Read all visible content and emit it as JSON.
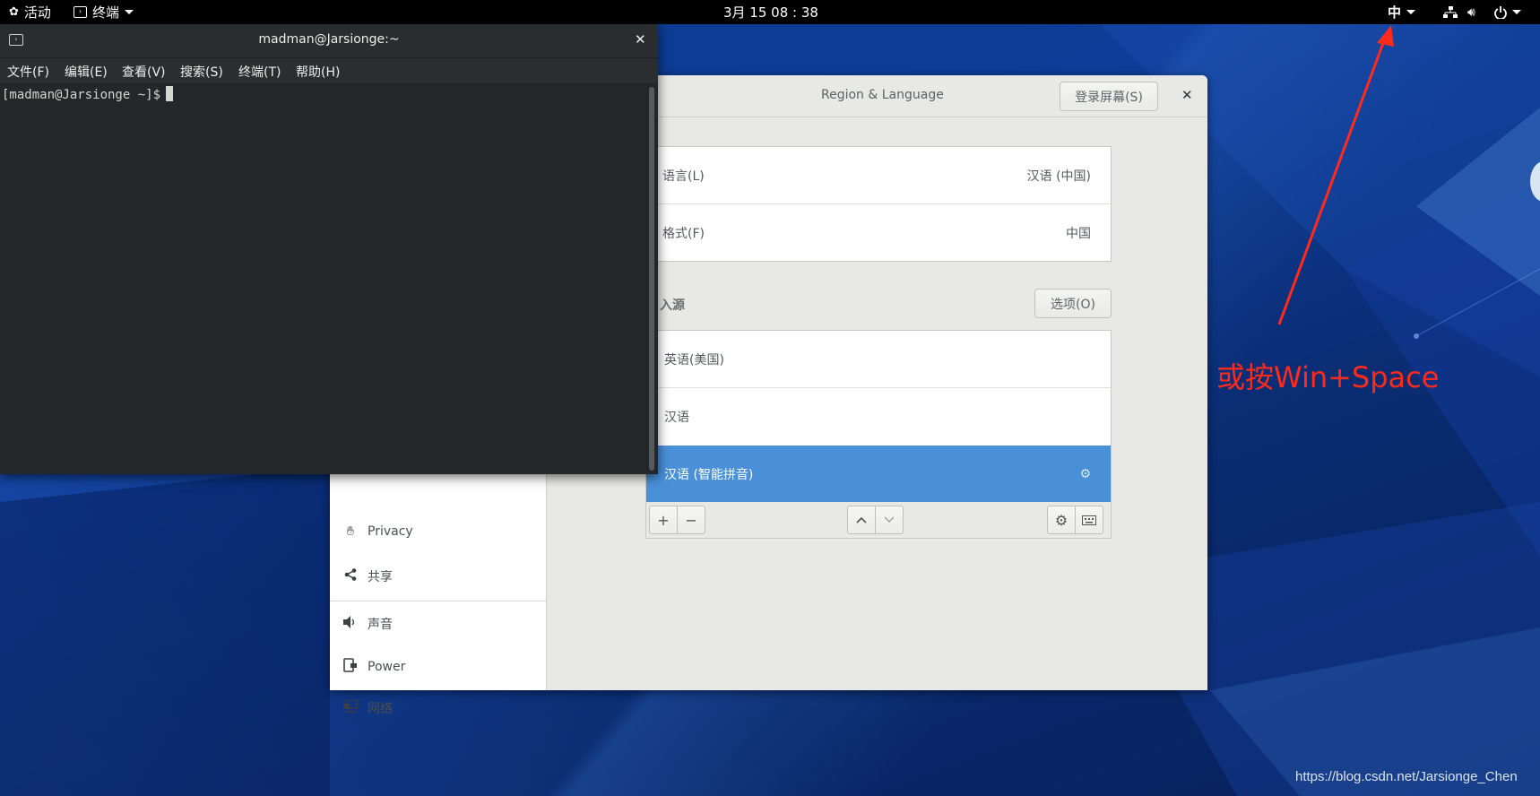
{
  "topbar": {
    "activities": "活动",
    "app_menu": "终端",
    "clock": "3月 15  08 : 38",
    "input_method": "中"
  },
  "settings": {
    "title": "Region & Language",
    "login_screen_button": "登录屏幕(S)",
    "language_label": "语言(L)",
    "language_value": "汉语 (中国)",
    "formats_label": "格式(F)",
    "formats_value": "中国",
    "input_sources_heading": "入源",
    "options_button": "选项(O)",
    "input_sources": [
      "英语(美国)",
      "汉语",
      "汉语 (智能拼音)"
    ],
    "sidebar": [
      {
        "label": "Privacy",
        "icon": "hand-icon"
      },
      {
        "label": "共享",
        "icon": "share-icon"
      },
      {
        "label": "声音",
        "icon": "speaker-icon"
      },
      {
        "label": "Power",
        "icon": "power-plug-icon"
      },
      {
        "label": "网络",
        "icon": "network-icon"
      }
    ],
    "accent": "#4a90d9"
  },
  "terminal": {
    "title": "madman@Jarsionge:~",
    "menu": [
      "文件(F)",
      "编辑(E)",
      "查看(V)",
      "搜索(S)",
      "终端(T)",
      "帮助(H)"
    ],
    "prompt": "[madman@Jarsionge ~]$"
  },
  "annotation": {
    "text": "或按Win+Space",
    "color": "#ff2a1a"
  },
  "watermark": "https://blog.csdn.net/Jarsionge_Chen"
}
